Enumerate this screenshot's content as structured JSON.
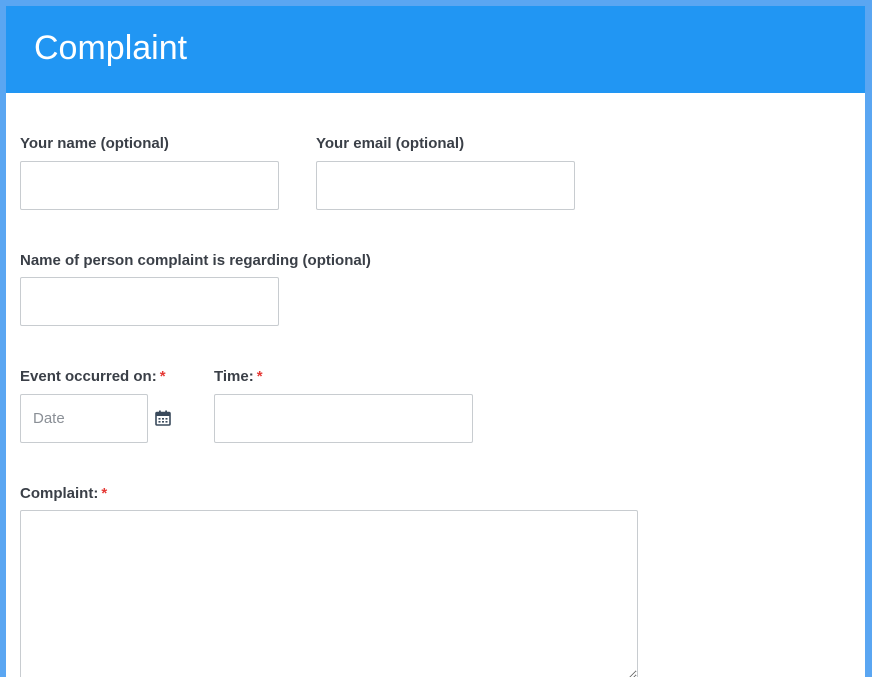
{
  "header": {
    "title": "Complaint"
  },
  "form": {
    "name": {
      "label": "Your name (optional)",
      "value": "",
      "placeholder": ""
    },
    "email": {
      "label": "Your email (optional)",
      "value": "",
      "placeholder": ""
    },
    "regarding": {
      "label": "Name of person complaint is regarding (optional)",
      "value": "",
      "placeholder": ""
    },
    "date": {
      "label": "Event occurred on:",
      "required_marker": "*",
      "value": "",
      "placeholder": "Date",
      "icon": "calendar-icon"
    },
    "time": {
      "label": "Time:",
      "required_marker": "*",
      "value": "",
      "placeholder": ""
    },
    "complaint": {
      "label": "Complaint:",
      "required_marker": "*",
      "value": "",
      "placeholder": ""
    }
  },
  "colors": {
    "header_bg": "#2196f3",
    "frame_bg": "#5aa6f2",
    "required": "#e53935"
  }
}
